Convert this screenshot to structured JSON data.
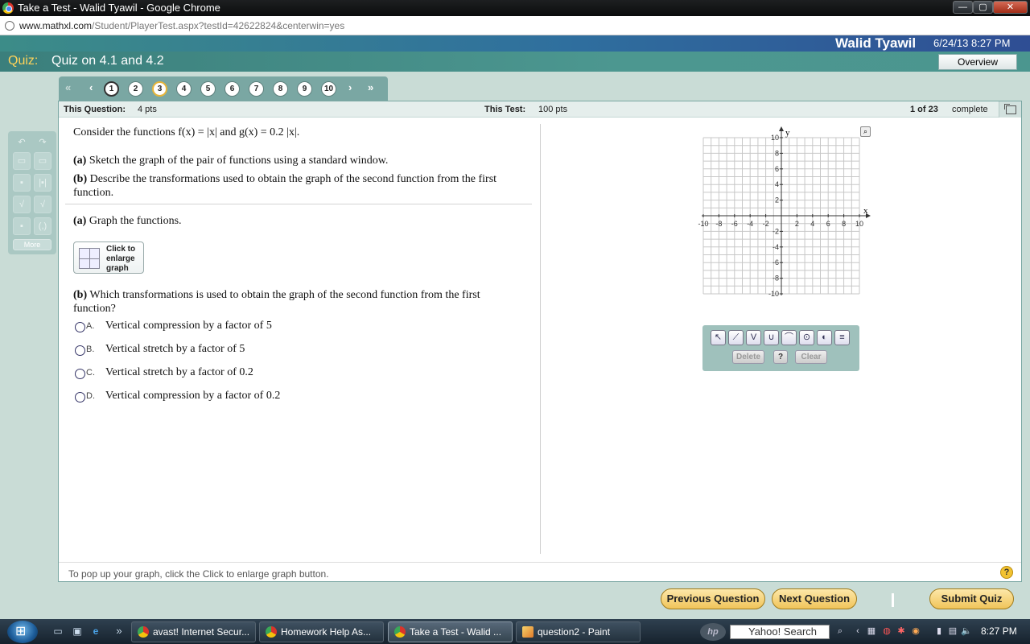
{
  "window": {
    "title": "Take a Test - Walid Tyawil - Google Chrome",
    "url_host": "www.mathxl.com",
    "url_path": "/Student/PlayerTest.aspx?testId=42622824&centerwin=yes"
  },
  "header": {
    "user_name": "Walid Tyawil",
    "datetime": "6/24/13 8:27 PM",
    "quiz_label": "Quiz:",
    "quiz_title": "Quiz on 4.1 and 4.2",
    "overview_label": "Overview"
  },
  "question_nav": {
    "first": "«",
    "prev": "‹",
    "next": "›",
    "last": "»",
    "numbers": [
      "1",
      "2",
      "3",
      "4",
      "5",
      "6",
      "7",
      "8",
      "9",
      "10"
    ]
  },
  "palette": {
    "undo": "↶",
    "redo": "↷",
    "more_label": "More"
  },
  "panel": {
    "this_question_label": "This Question:",
    "this_question_value": "4 pts",
    "this_test_label": "This Test:",
    "this_test_value": "100 pts",
    "progress": "1 of 23",
    "progress_status": "complete"
  },
  "question": {
    "intro": "Consider the functions f(x) = |x| and g(x) = 0.2 |x|.",
    "part_a_tag": "(a)",
    "part_a": "Sketch the graph of the pair of functions using a standard window.",
    "part_b_tag": "(b)",
    "part_b": "Describe the transformations used to obtain the graph of the second function from the first function.",
    "a_heading_tag": "(a)",
    "a_heading": "Graph the functions.",
    "enlarge_label": "Click to enlarge graph",
    "b_heading_tag": "(b)",
    "b_heading": "Which transformations is used to obtain the graph of the second function from the first function?",
    "options": [
      {
        "letter": "A.",
        "text": "Vertical compression by a factor of 5"
      },
      {
        "letter": "B.",
        "text": "Vertical stretch by a factor of 5"
      },
      {
        "letter": "C.",
        "text": "Vertical stretch by a factor of 0.2"
      },
      {
        "letter": "D.",
        "text": "Vertical compression by a factor of 0.2"
      }
    ]
  },
  "graph": {
    "x_label": "x",
    "y_label": "y",
    "xlim": [
      -10,
      10
    ],
    "ylim": [
      -10,
      10
    ],
    "grid": true,
    "tick_labels": [
      "-10",
      "-8",
      "-6",
      "-4",
      "-2",
      "2",
      "4",
      "6",
      "8",
      "10"
    ]
  },
  "graph_tools": {
    "delete_label": "Delete",
    "help_label": "?",
    "clear_label": "Clear"
  },
  "footer": {
    "hint": "To pop up your graph, click the Click to enlarge graph button.",
    "help": "?",
    "prev_label": "Previous Question",
    "next_label": "Next Question",
    "submit_label": "Submit Quiz"
  },
  "taskbar": {
    "tasks": [
      {
        "label": "avast! Internet Secur..."
      },
      {
        "label": "Homework Help As..."
      },
      {
        "label": "Take a Test - Walid ..."
      },
      {
        "label": "question2 - Paint"
      }
    ],
    "hp": "hp",
    "search_label": "Yahoo! Search",
    "clock": "8:27 PM"
  },
  "colors": {
    "header_teal": "#4b968f",
    "quiz_label_yellow": "#ffd35a",
    "button_gold": "#f0c45a"
  }
}
